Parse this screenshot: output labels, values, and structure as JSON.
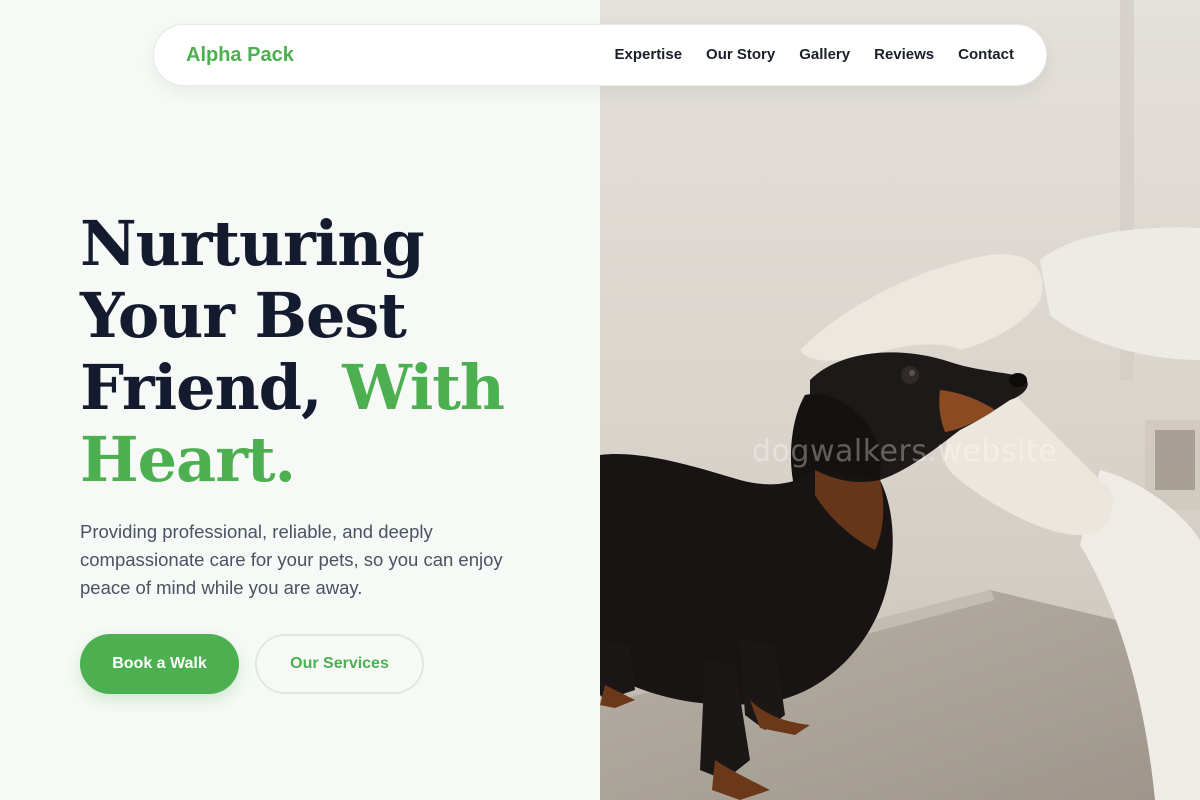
{
  "navbar": {
    "brand": "Alpha Pack",
    "links": [
      "Expertise",
      "Our Story",
      "Gallery",
      "Reviews",
      "Contact"
    ]
  },
  "hero": {
    "title_line1": "Nurturing",
    "title_line2": "Your Best",
    "title_line3_plain": "Friend, ",
    "title_line3_accent": "With",
    "title_line4_accent": "Heart.",
    "description": "Providing professional, reliable, and deeply compassionate care for your pets, so you can enjoy peace of mind while you are away.",
    "primary_button": "Book a Walk",
    "secondary_button": "Our Services"
  },
  "image": {
    "subject": "dachshund-vet-exam-photo",
    "watermark": "dogwalkers.website"
  },
  "colors": {
    "accent": "#4caf50",
    "heading": "#141b2e",
    "body_text": "#4a5263",
    "background": "#f6f9f5"
  }
}
